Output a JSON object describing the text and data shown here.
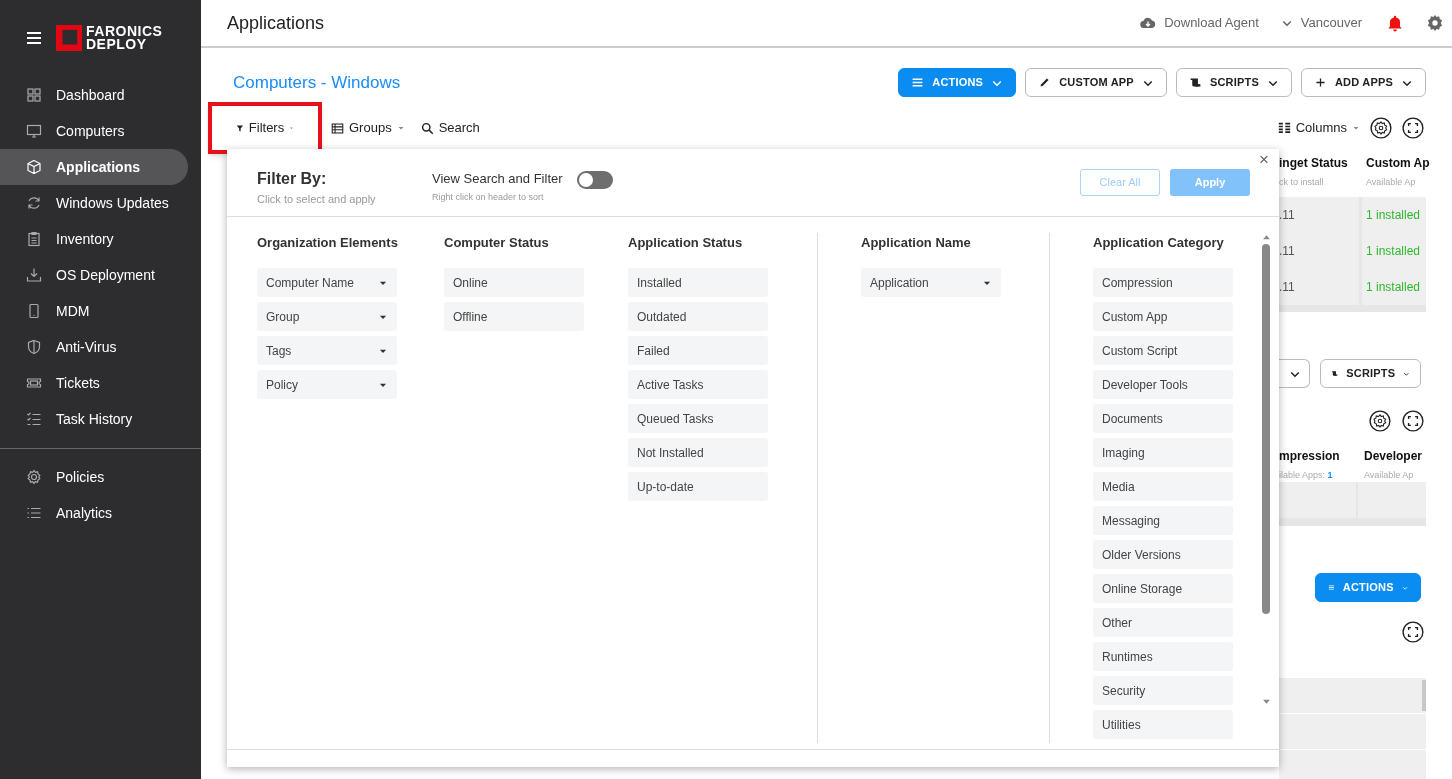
{
  "header": {
    "title": "Applications",
    "download_agent": "Download Agent",
    "location": "Vancouver"
  },
  "sidebar": {
    "brand_line1": "FARONICS",
    "brand_line2": "DEPLOY",
    "items": [
      {
        "label": "Dashboard",
        "selected": false
      },
      {
        "label": "Computers",
        "selected": false
      },
      {
        "label": "Applications",
        "selected": true
      },
      {
        "label": "Windows Updates",
        "selected": false
      },
      {
        "label": "Inventory",
        "selected": false
      },
      {
        "label": "OS Deployment",
        "selected": false
      },
      {
        "label": "MDM",
        "selected": false
      },
      {
        "label": "Anti-Virus",
        "selected": false
      },
      {
        "label": "Tickets",
        "selected": false
      },
      {
        "label": "Task History",
        "selected": false
      }
    ],
    "secondary_items": [
      {
        "label": "Policies",
        "selected": false
      },
      {
        "label": "Analytics",
        "selected": false
      }
    ]
  },
  "page": {
    "breadcrumb": "Computers - Windows",
    "toolbar_buttons": [
      {
        "label": "ACTIONS",
        "kind": "primary"
      },
      {
        "label": "CUSTOM APP",
        "kind": "outline"
      },
      {
        "label": "SCRIPTS",
        "kind": "outline"
      },
      {
        "label": "ADD APPS",
        "kind": "outline"
      }
    ],
    "filter_tabs": [
      {
        "label": "Filters",
        "highlighted": true
      },
      {
        "label": "Groups",
        "highlighted": false
      },
      {
        "label": "Search",
        "highlighted": false
      }
    ],
    "columns_button": "Columns"
  },
  "backdrop": {
    "table_headers": [
      {
        "title": "inget Status",
        "subtitle": "ck to install"
      },
      {
        "title": "Custom Ap",
        "subtitle": "Available Ap"
      }
    ],
    "table_rows": [
      [
        ".11",
        "1 installed"
      ],
      [
        ".11",
        "1 installed"
      ],
      [
        ".11",
        "1 installed"
      ]
    ],
    "second_buttons": [
      {
        "partial": true
      },
      {
        "label": "SCRIPTS",
        "partial": false
      }
    ],
    "second_headers": [
      {
        "title": "mpression",
        "subtitle": "ilable Apps:",
        "count": "1"
      },
      {
        "title": "Developer",
        "subtitle": "Available Ap"
      }
    ],
    "third_button": {
      "label": "ACTIONS"
    }
  },
  "filter_panel": {
    "title": "Filter By:",
    "subtitle": "Click to select and apply",
    "view_toggle": {
      "label": "View Search and Filter",
      "hint": "Right click on header to sort",
      "on": false
    },
    "clear_all": {
      "label": "Clear All",
      "disabled": true
    },
    "apply": {
      "label": "Apply",
      "disabled": true
    },
    "close": "×",
    "groups": [
      {
        "title": "Organization Elements",
        "kind": "dropdown",
        "items": [
          "Computer Name",
          "Group",
          "Tags",
          "Policy"
        ]
      },
      {
        "title": "Computer Status",
        "kind": "option",
        "items": [
          "Online",
          "Offline"
        ]
      },
      {
        "title": "Application Status",
        "kind": "option",
        "items": [
          "Installed",
          "Outdated",
          "Failed",
          "Active Tasks",
          "Queued Tasks",
          "Not Installed",
          "Up-to-date"
        ]
      },
      {
        "title": "Application Name",
        "kind": "dropdown",
        "items": [
          "Application"
        ]
      },
      {
        "title": "Application Category",
        "kind": "option",
        "items": [
          "Compression",
          "Custom App",
          "Custom Script",
          "Developer Tools",
          "Documents",
          "Imaging",
          "Media",
          "Messaging",
          "Older Versions",
          "Online Storage",
          "Other",
          "Runtimes",
          "Security",
          "Utilities"
        ]
      }
    ]
  }
}
